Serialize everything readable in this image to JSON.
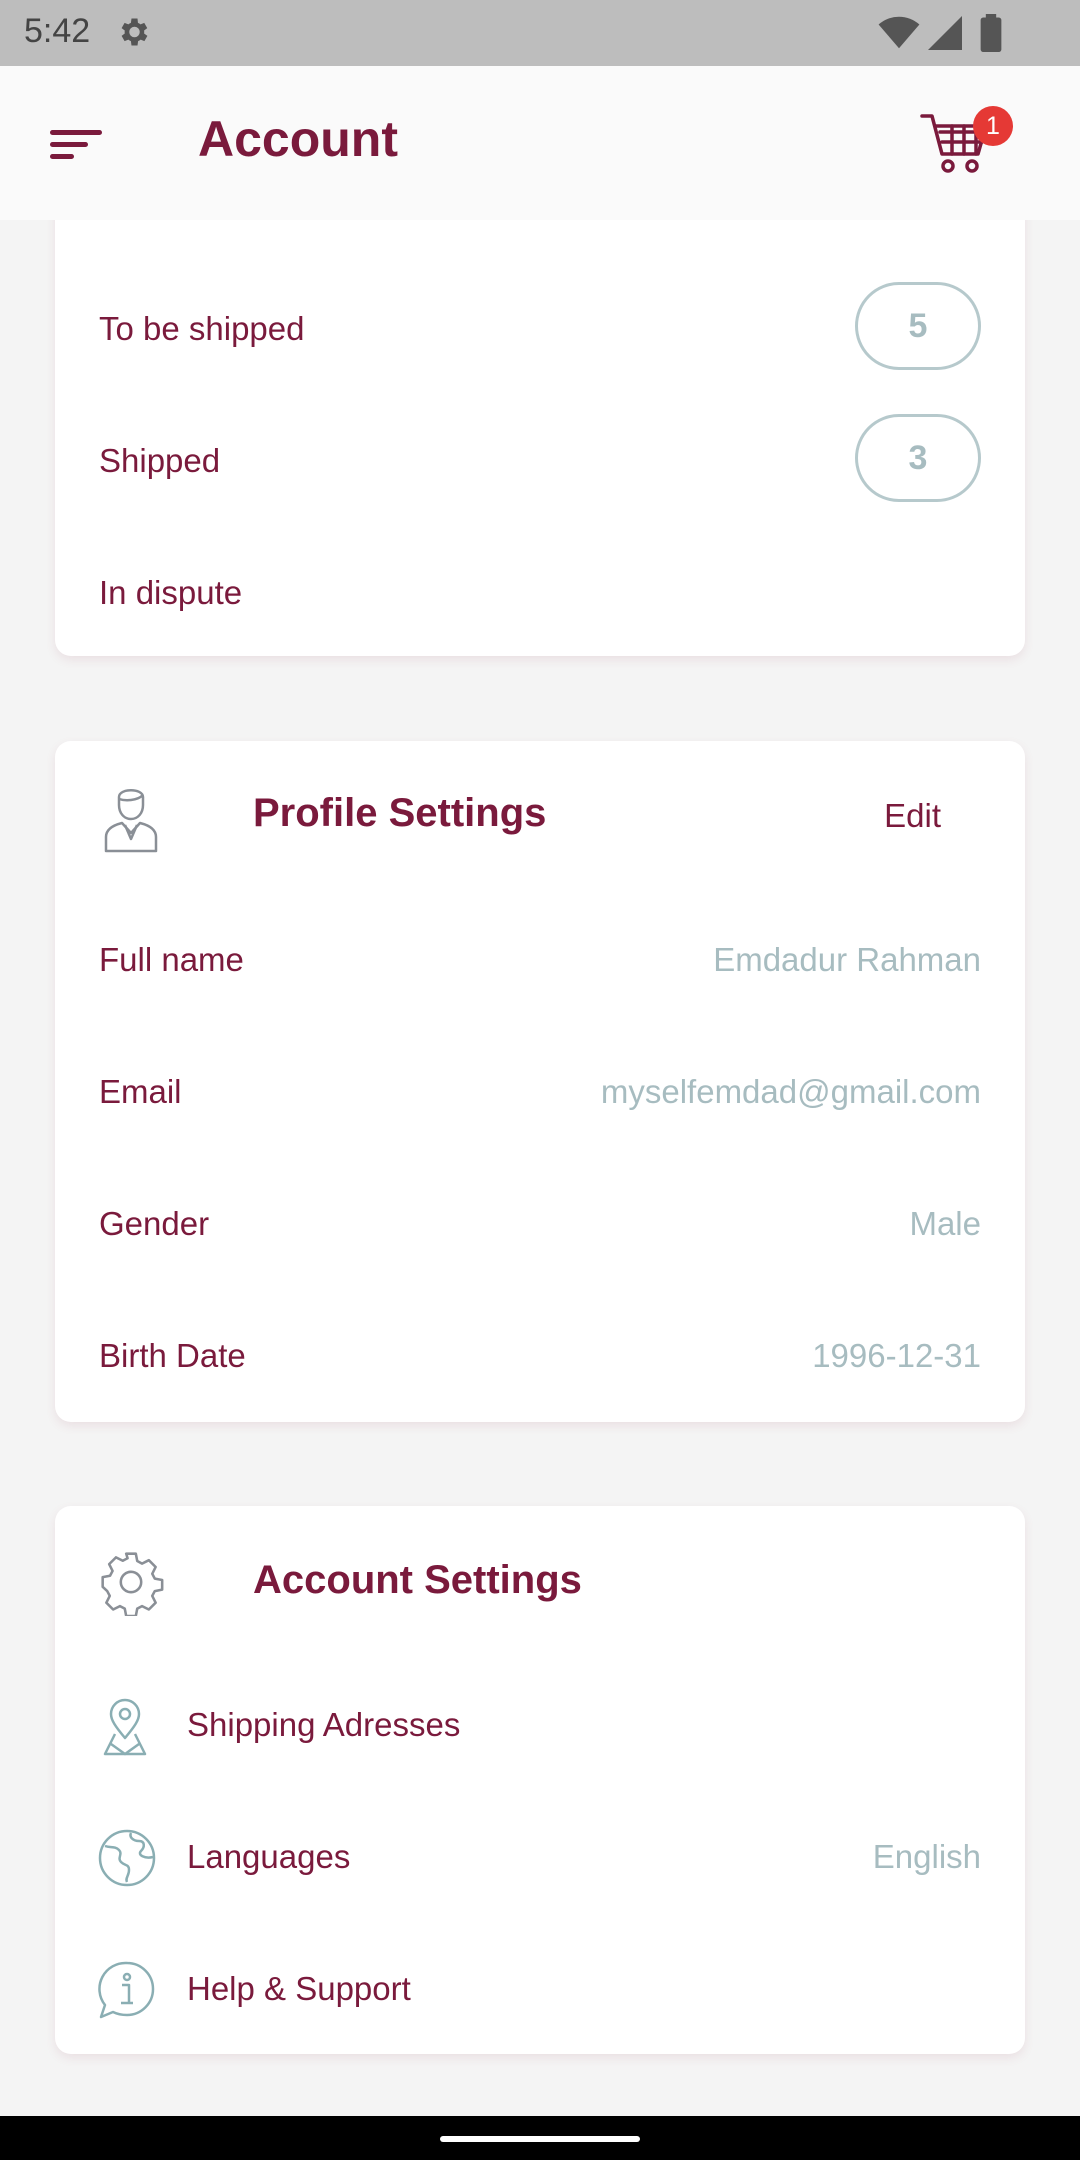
{
  "status_bar": {
    "time": "5:42"
  },
  "app_bar": {
    "title": "Account",
    "cart_badge": "1"
  },
  "orders": {
    "items": [
      {
        "label": "To be shipped",
        "count": "5"
      },
      {
        "label": "Shipped",
        "count": "3"
      },
      {
        "label": "In dispute"
      }
    ]
  },
  "profile_settings": {
    "title": "Profile Settings",
    "edit_label": "Edit",
    "fields": [
      {
        "label": "Full name",
        "value": "Emdadur Rahman"
      },
      {
        "label": "Email",
        "value": "myselfemdad@gmail.com"
      },
      {
        "label": "Gender",
        "value": "Male"
      },
      {
        "label": "Birth Date",
        "value": "1996-12-31"
      }
    ]
  },
  "account_settings": {
    "title": "Account Settings",
    "items": [
      {
        "label": "Shipping Adresses",
        "icon": "map-pin-icon"
      },
      {
        "label": "Languages",
        "value": "English",
        "icon": "globe-icon"
      },
      {
        "label": "Help & Support",
        "icon": "info-chat-icon"
      }
    ]
  },
  "colors": {
    "primary": "#7a1a3c",
    "muted": "#a7bcc0",
    "badge": "#e53935",
    "background": "#f4f4f4"
  }
}
